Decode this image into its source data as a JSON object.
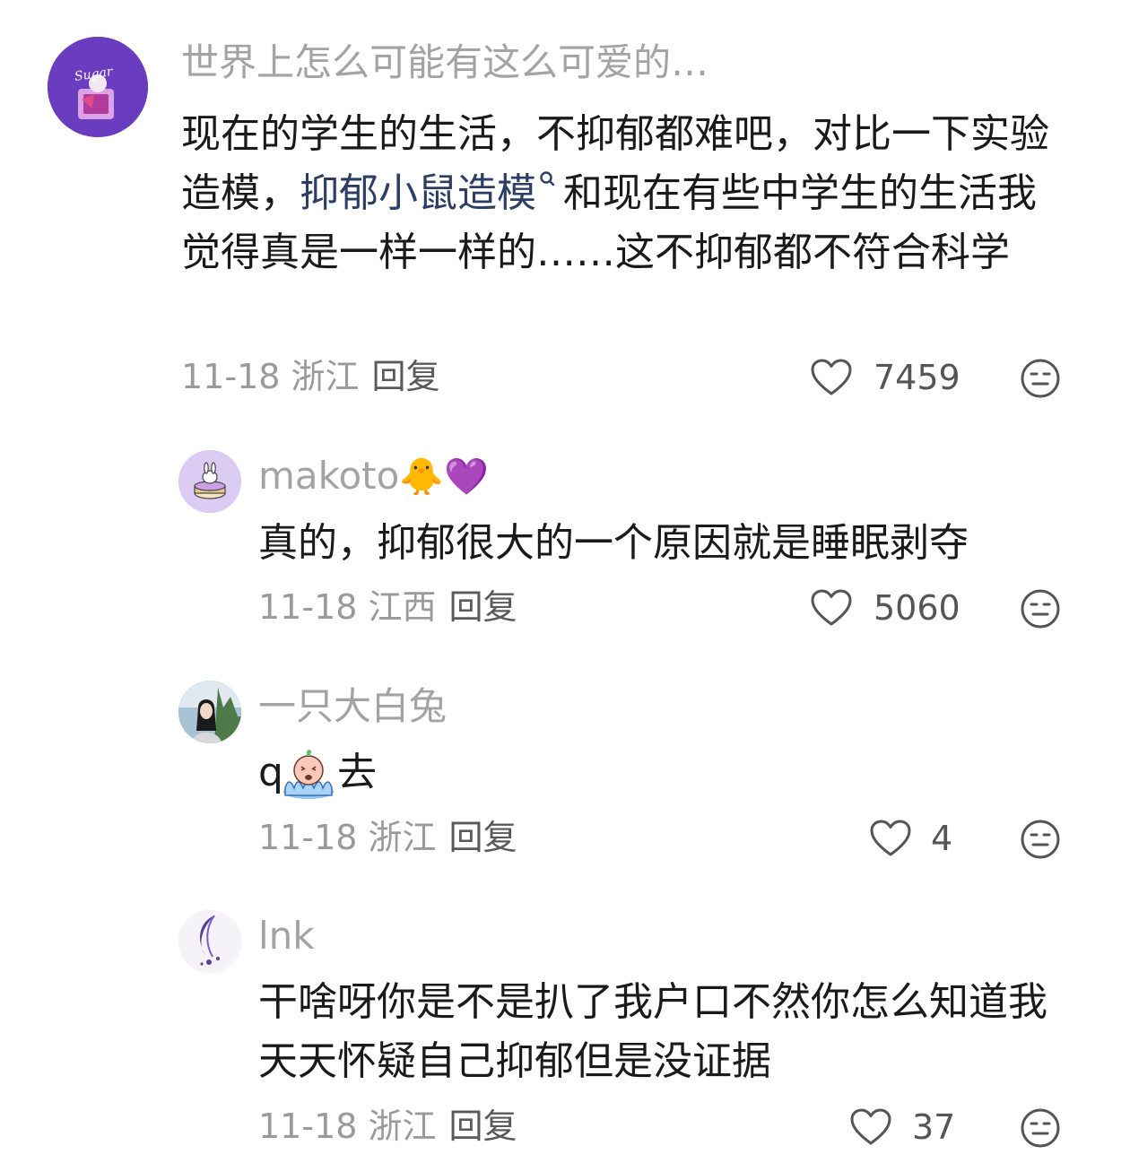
{
  "comments": [
    {
      "username": "世界上怎么可能有这么可爱的…",
      "text_before_link": "现在的学生的生活，不抑郁都难吧，对比一下实验造模，",
      "link_text": "抑郁小鼠造模",
      "text_after_link": "和现在有些中学生的生活我觉得真是一样一样的……这不抑郁都不符合科学",
      "date": "11-18",
      "location": "浙江",
      "reply_label": "回复",
      "likes": "7459",
      "avatar_label": "Sugar"
    },
    {
      "username": "makoto",
      "username_emoji": "🐥💜",
      "text": "真的，抑郁很大的一个原因就是睡眠剥夺",
      "date": "11-18",
      "location": "江西",
      "reply_label": "回复",
      "likes": "5060"
    },
    {
      "username": "一只大白兔",
      "text_before_emoji": "q",
      "text_after_emoji": "去",
      "date": "11-18",
      "location": "浙江",
      "reply_label": "回复",
      "likes": "4"
    },
    {
      "username": "lnk",
      "text": "干啥呀你是不是扒了我户口不然你怎么知道我天天怀疑自己抑郁但是没证据",
      "date": "11-18",
      "location": "浙江",
      "reply_label": "回复",
      "likes": "37"
    }
  ],
  "icons": {
    "like": "heart-outline-icon",
    "dislike": "meh-face-icon",
    "search": "search-icon",
    "emoji_cry": "crying-face-emoji"
  },
  "colors": {
    "username": "#a3a3a3",
    "body": "#1a1a1a",
    "meta": "#9a9a9a",
    "link": "#2c3e64",
    "avatar_primary": "#6d3fc2"
  }
}
